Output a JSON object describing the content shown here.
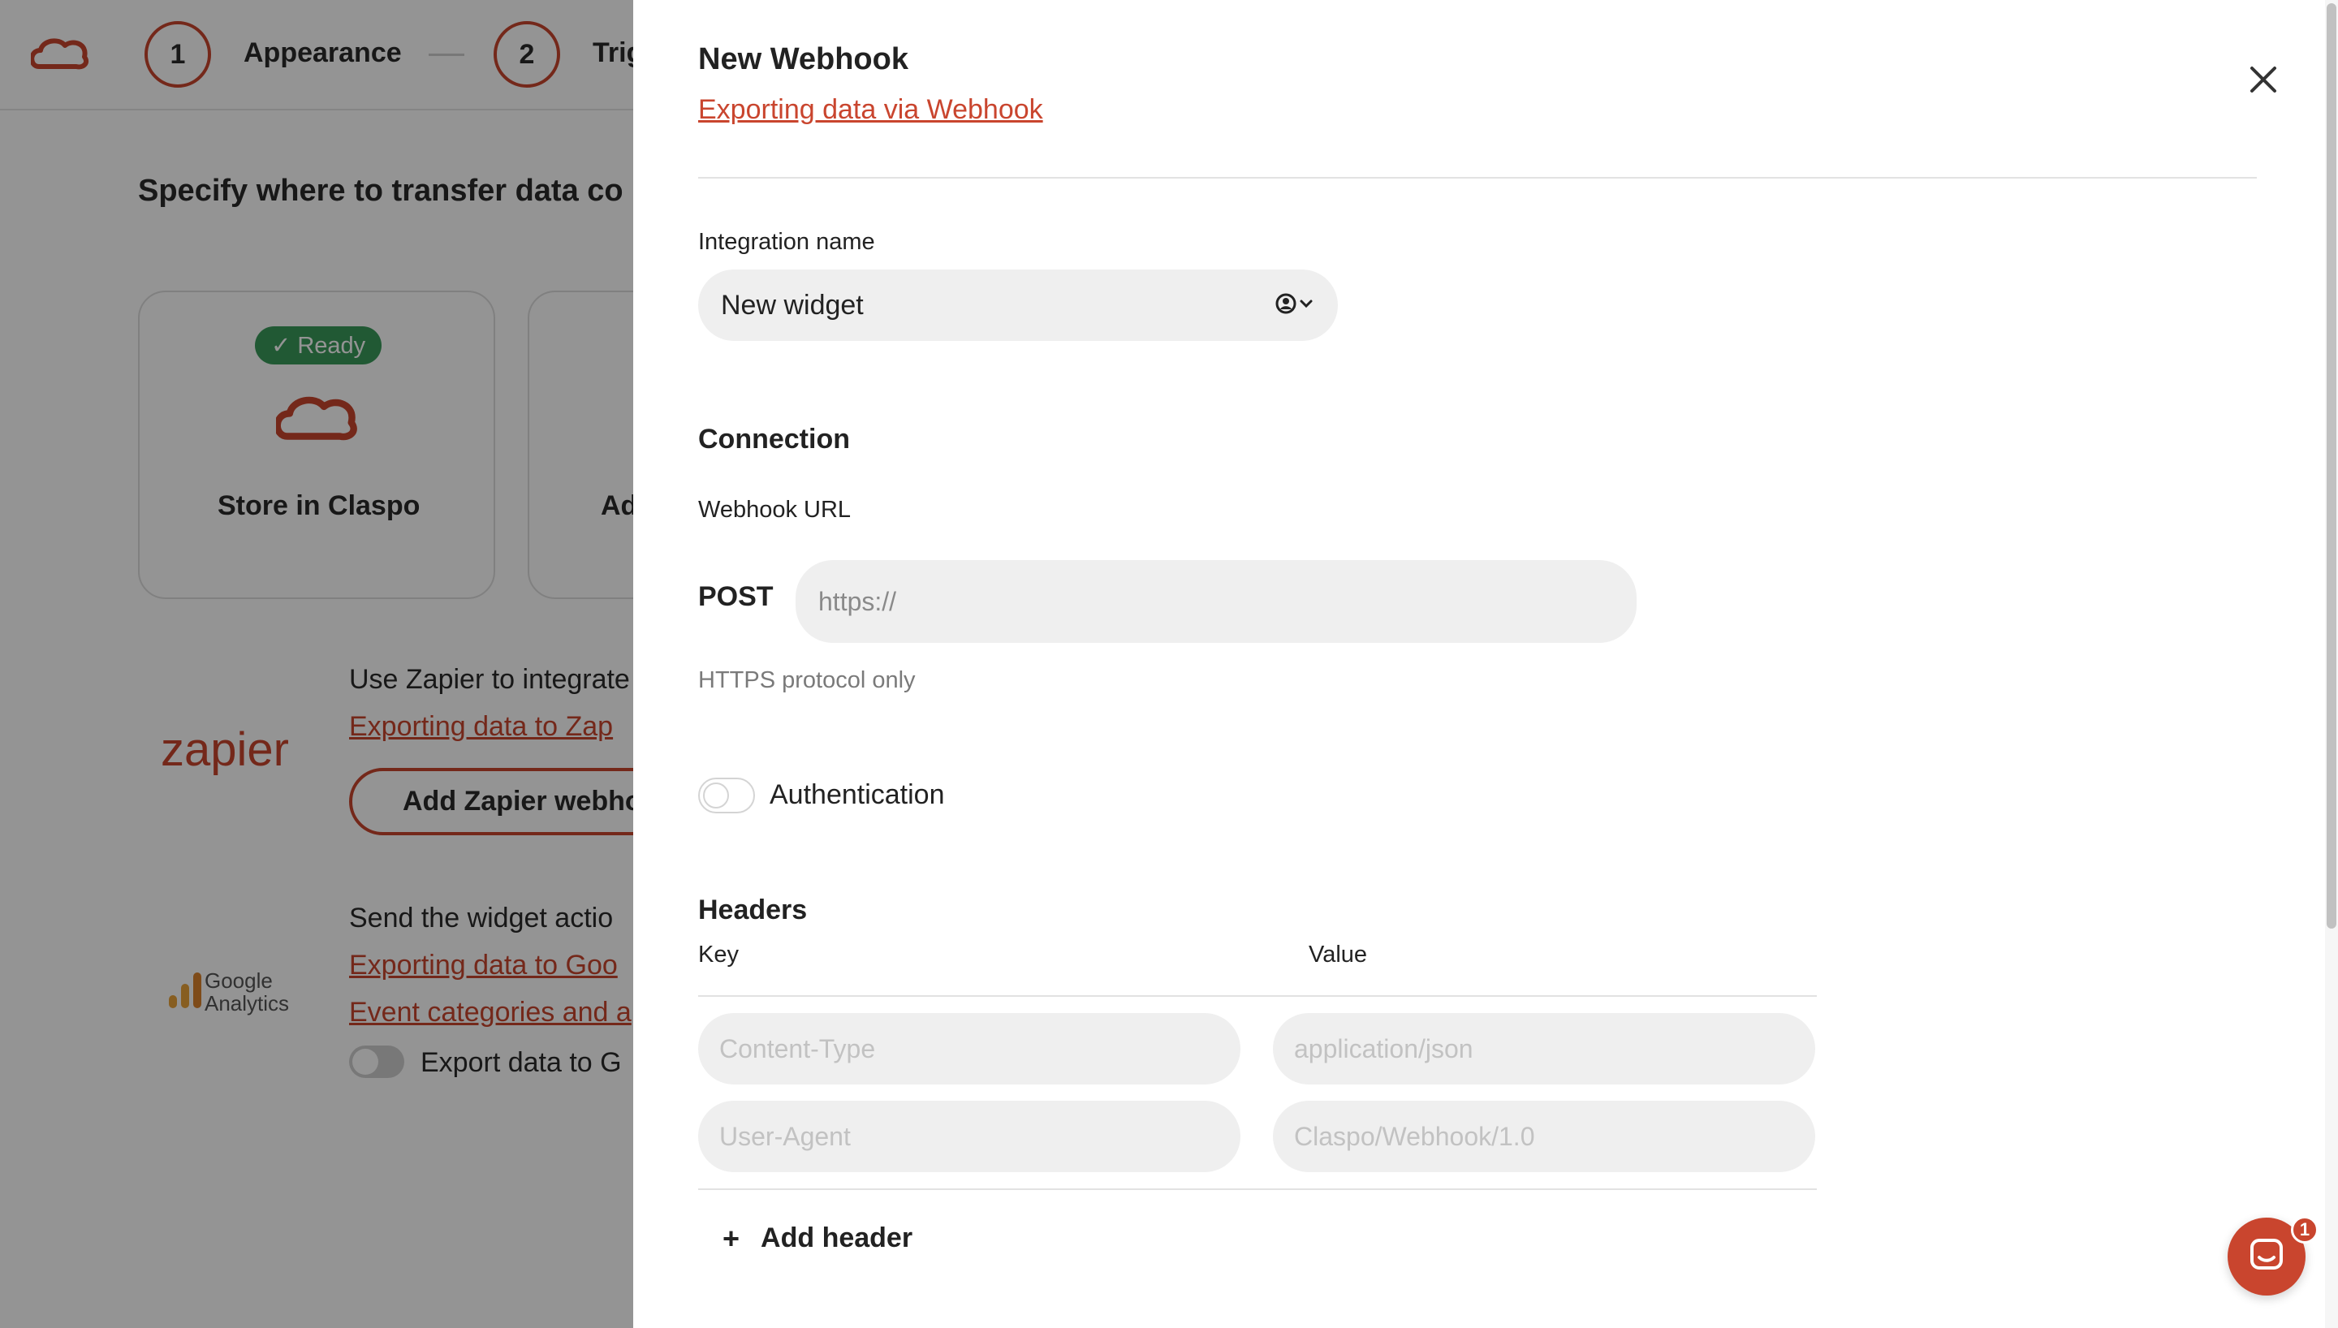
{
  "background": {
    "steps": [
      {
        "number": "1",
        "label": "Appearance"
      },
      {
        "number": "2",
        "label": "Trig"
      }
    ],
    "heading": "Specify where to transfer data co",
    "cards": [
      {
        "badge": "✓ Ready",
        "title": "Store in Claspo"
      },
      {
        "title": "Ad"
      }
    ],
    "zapier": {
      "logo_text": "zapier",
      "text": "Use Zapier to integrate",
      "link": "Exporting data to Zap",
      "button": "Add Zapier webho"
    },
    "google_analytics": {
      "logo_line1": "Google",
      "logo_line2": "Analytics",
      "text": "Send the widget actio",
      "link1": "Exporting data to Goo",
      "link2": "Event categories and a",
      "toggle_label": "Export data to G"
    }
  },
  "drawer": {
    "title": "New Webhook",
    "help_link": "Exporting data via Webhook",
    "integration_name": {
      "label": "Integration name",
      "value": "New widget"
    },
    "connection": {
      "title": "Connection",
      "url_label": "Webhook URL",
      "method": "POST",
      "url_placeholder": "https://",
      "hint": "HTTPS protocol only"
    },
    "authentication": {
      "label": "Authentication",
      "enabled": false
    },
    "headers": {
      "title": "Headers",
      "key_label": "Key",
      "value_label": "Value",
      "rows": [
        {
          "key_placeholder": "Content-Type",
          "value_placeholder": "application/json"
        },
        {
          "key_placeholder": "User-Agent",
          "value_placeholder": "Claspo/Webhook/1.0"
        }
      ],
      "add_label": "Add header"
    }
  },
  "chat": {
    "badge": "1"
  },
  "colors": {
    "accent": "#c9452e",
    "ready_green": "#3a9a5b",
    "input_bg": "#efefef",
    "overlay": "rgba(0,0,0,0.42)"
  }
}
